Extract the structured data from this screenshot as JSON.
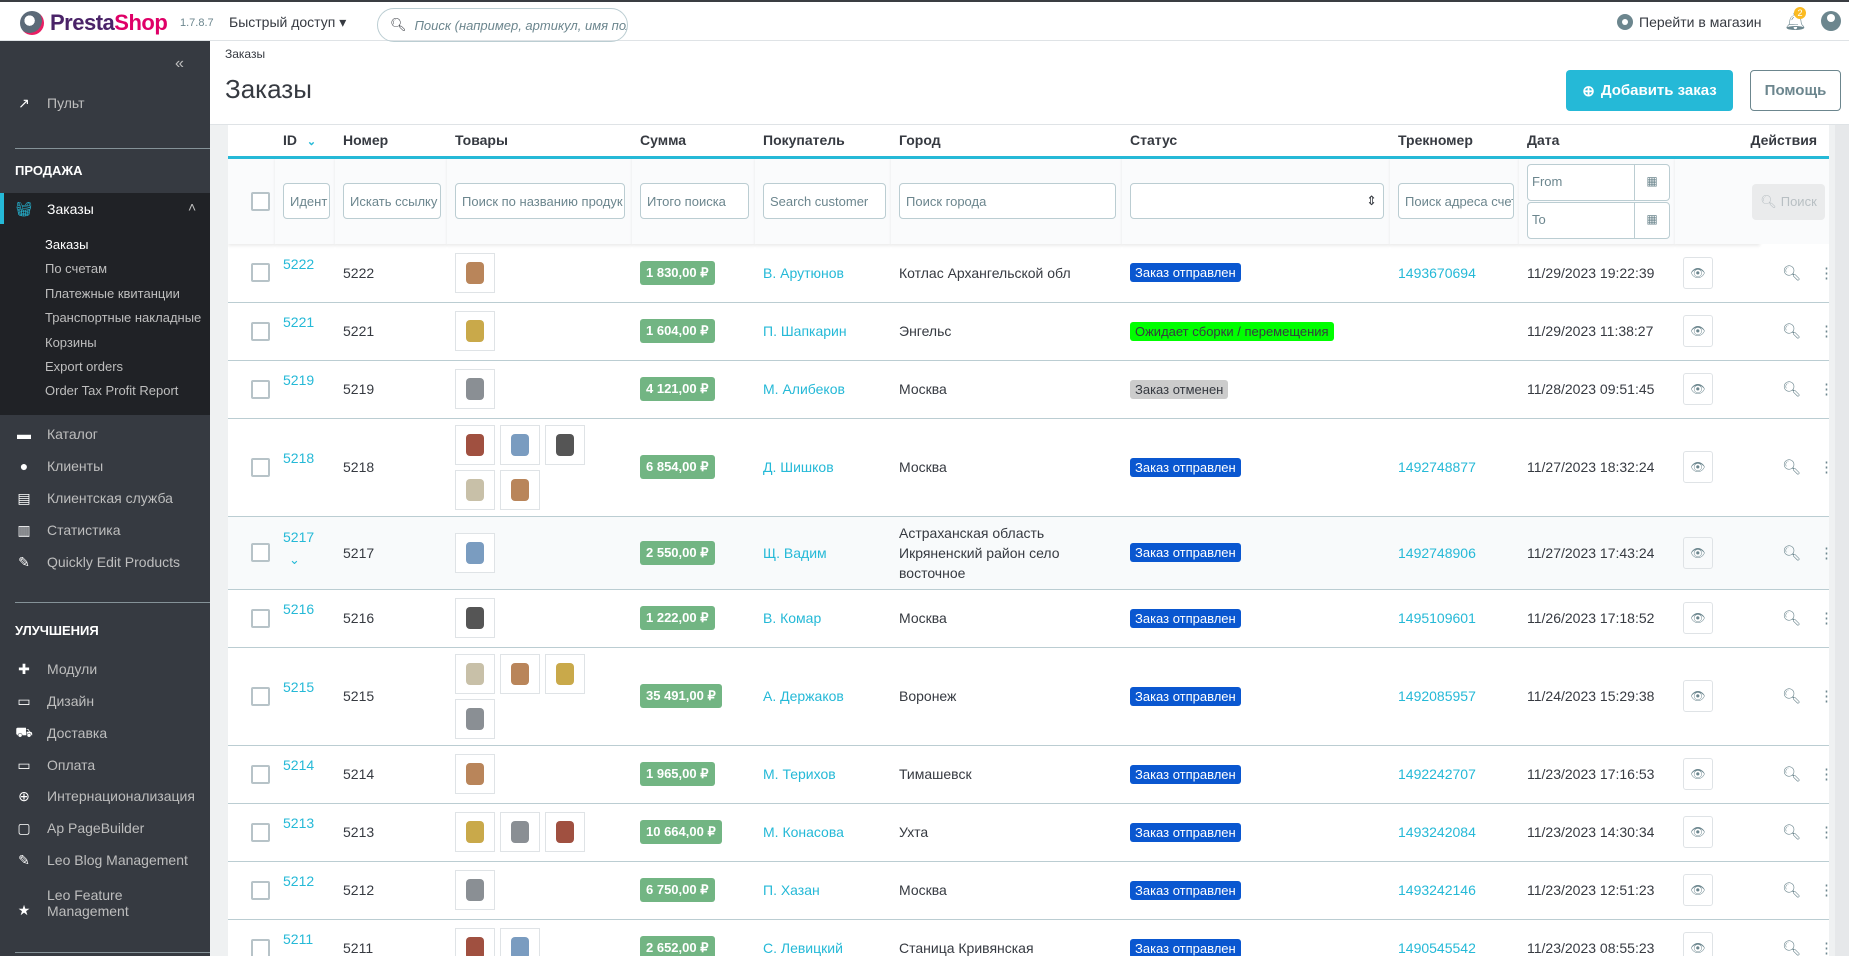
{
  "topbar": {
    "logo_a": "Presta",
    "logo_b": "Shop",
    "version": "1.7.8.7",
    "quick_access": "Быстрый доступ",
    "search_placeholder": "Поиск (например, артикул, имя пол",
    "go_to_shop": "Перейти в магазин",
    "notifications_count": "2"
  },
  "sidebar": {
    "dashboard": "Пульт",
    "sell_header": "ПРОДАЖА",
    "orders": "Заказы",
    "orders_sub": [
      "Заказы",
      "По счетам",
      "Платежные квитанции",
      "Транспортные накладные",
      "Корзины",
      "Export orders",
      "Order Tax Profit Report"
    ],
    "items": [
      "Каталог",
      "Клиенты",
      "Клиентская служба",
      "Статистика",
      "Quickly Edit Products"
    ],
    "improve_header": "УЛУЧШЕНИЯ",
    "improve_items": [
      "Модули",
      "Дизайн",
      "Доставка",
      "Оплата",
      "Интернационализация",
      "Ap PageBuilder",
      "Leo Blog Management"
    ],
    "leo_feature_1": "Leo Feature",
    "leo_feature_2": "Management"
  },
  "header": {
    "breadcrumb": "Заказы",
    "title": "Заказы",
    "add_order": "Добавить заказ",
    "help": "Помощь"
  },
  "table": {
    "columns": [
      "ID",
      "Номер",
      "Товары",
      "Сумма",
      "Покупатель",
      "Город",
      "Статус",
      "Трекномер",
      "Дата",
      "Действия"
    ],
    "filters": {
      "id": "Идент",
      "number": "Искать ссылку",
      "products": "Поиск по названию продук",
      "total": "Итого поиска",
      "customer": "Search customer",
      "city": "Поиск города",
      "tracking": "Поиск адреса счет",
      "date_from": "From",
      "date_to": "To",
      "search_button": "Поиск"
    },
    "rows": [
      {
        "id": "5222",
        "number": "5222",
        "products": 1,
        "total": "1 830,00 ₽",
        "customer": "В. Арутюнов",
        "city": "Котлас Архангельской обл",
        "status": "Заказ отправлен",
        "status_color": "#0a57d0",
        "tracking": "1493670694",
        "date": "11/29/2023 19:22:39"
      },
      {
        "id": "5221",
        "number": "5221",
        "products": 1,
        "total": "1 604,00 ₽",
        "customer": "П. Шапкарин",
        "city": "Энгельс",
        "status": "Ожидает сборки / перемещения",
        "status_color": "#00ff00",
        "tracking": "",
        "date": "11/29/2023 11:38:27"
      },
      {
        "id": "5219",
        "number": "5219",
        "products": 1,
        "total": "4 121,00 ₽",
        "customer": "М. Алибеков",
        "city": "Москва",
        "status": "Заказ отменен",
        "status_color": "#cccccc",
        "tracking": "",
        "date": "11/28/2023 09:51:45"
      },
      {
        "id": "5218",
        "number": "5218",
        "products": 5,
        "total": "6 854,00 ₽",
        "customer": "Д. Шишков",
        "city": "Москва",
        "status": "Заказ отправлен",
        "status_color": "#0a57d0",
        "tracking": "1492748877",
        "date": "11/27/2023 18:32:24"
      },
      {
        "id": "5217",
        "number": "5217",
        "products": 1,
        "total": "2 550,00 ₽",
        "customer": "Щ. Вадим",
        "city": "Астраханская область Икряненский район село восточное",
        "status": "Заказ отправлен",
        "status_color": "#0a57d0",
        "tracking": "1492748906",
        "date": "11/27/2023 17:43:24",
        "expanded": true
      },
      {
        "id": "5216",
        "number": "5216",
        "products": 1,
        "total": "1 222,00 ₽",
        "customer": "В. Комар",
        "city": "Москва",
        "status": "Заказ отправлен",
        "status_color": "#0a57d0",
        "tracking": "1495109601",
        "date": "11/26/2023 17:18:52"
      },
      {
        "id": "5215",
        "number": "5215",
        "products": 4,
        "total": "35 491,00 ₽",
        "customer": "А. Держаков",
        "city": "Воронеж",
        "status": "Заказ отправлен",
        "status_color": "#0a57d0",
        "tracking": "1492085957",
        "date": "11/24/2023 15:29:38"
      },
      {
        "id": "5214",
        "number": "5214",
        "products": 1,
        "total": "1 965,00 ₽",
        "customer": "М. Терихов",
        "city": "Тимашевск",
        "status": "Заказ отправлен",
        "status_color": "#0a57d0",
        "tracking": "1492242707",
        "date": "11/23/2023 17:16:53"
      },
      {
        "id": "5213",
        "number": "5213",
        "products": 3,
        "total": "10 664,00 ₽",
        "customer": "М. Конасова",
        "city": "Ухта",
        "status": "Заказ отправлен",
        "status_color": "#0a57d0",
        "tracking": "1493242084",
        "date": "11/23/2023 14:30:34"
      },
      {
        "id": "5212",
        "number": "5212",
        "products": 1,
        "total": "6 750,00 ₽",
        "customer": "П. Хазан",
        "city": "Москва",
        "status": "Заказ отправлен",
        "status_color": "#0a57d0",
        "tracking": "1493242146",
        "date": "11/23/2023 12:51:23"
      },
      {
        "id": "5211",
        "number": "5211",
        "products": 2,
        "total": "2 652,00 ₽",
        "customer": "С. Левицкий",
        "city": "Станица Кривянская",
        "status": "Заказ отправлен",
        "status_color": "#0a57d0",
        "tracking": "1490545542",
        "date": "11/23/2023 08:55:23"
      }
    ]
  },
  "colors": {
    "accent": "#25b9d7",
    "amount": "#72b583",
    "sidebar": "#363a41"
  }
}
